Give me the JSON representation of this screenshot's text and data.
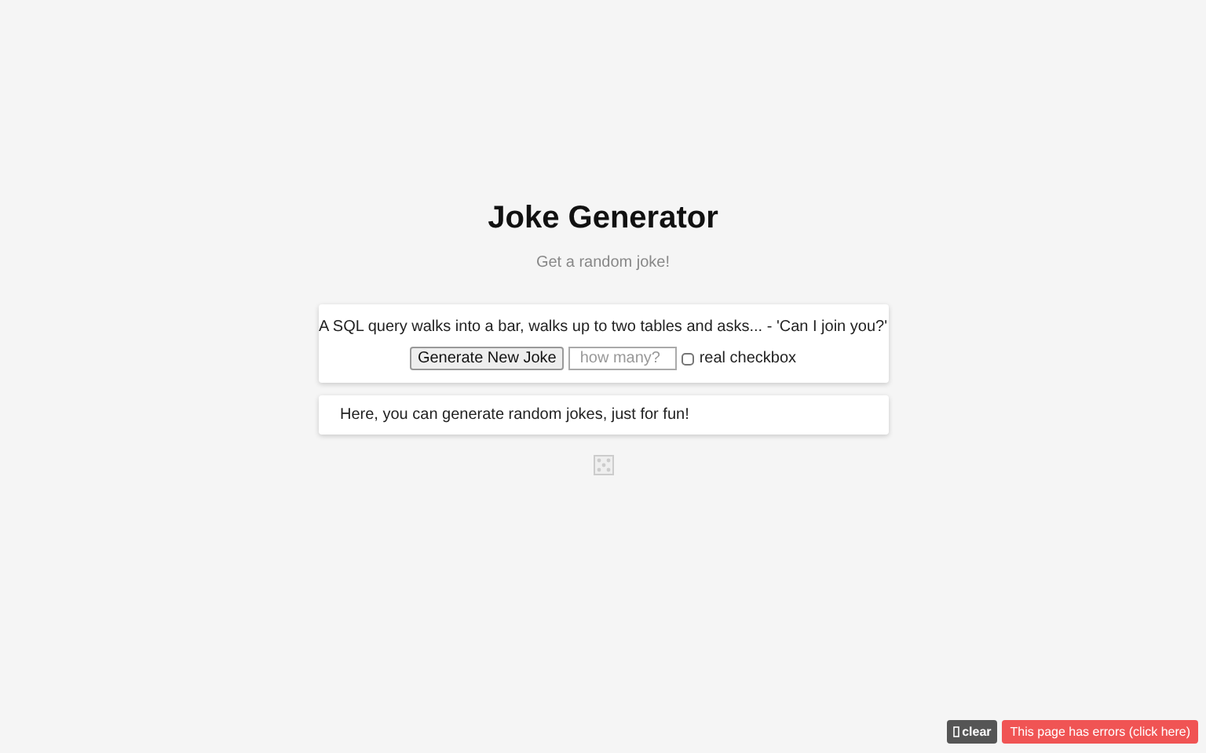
{
  "header": {
    "title": "Joke Generator",
    "subtitle": "Get a random joke!"
  },
  "joke_card": {
    "joke": "A SQL query walks into a bar, walks up to two tables and asks... - 'Can I join you?'",
    "button": "Generate New Joke",
    "count_field": {
      "placeholder": "how many?"
    },
    "checkbox": {
      "label": "real checkbox",
      "checked": false
    }
  },
  "info_card": {
    "text": "Here, you can generate random jokes, just for fun!"
  },
  "error_bar": {
    "clear_button": "clear",
    "error_button": "This page has errors (click here)"
  }
}
